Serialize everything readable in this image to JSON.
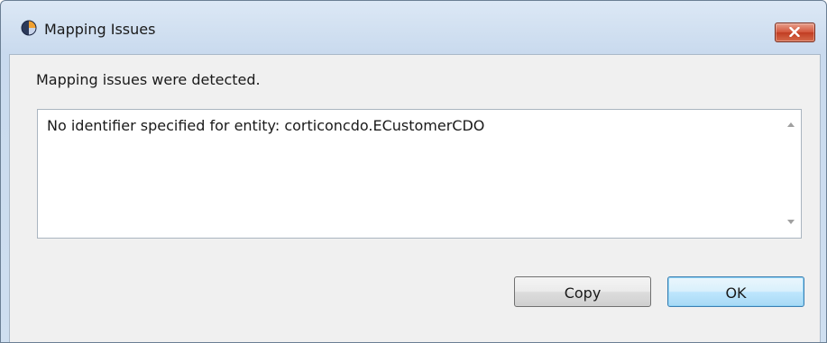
{
  "window": {
    "title": "Mapping Issues",
    "app_icon": "eclipse-app-icon",
    "close_icon": "close-x-icon",
    "close_button_color": "#c13d22"
  },
  "dialog": {
    "message": "Mapping issues were detected.",
    "issues_text": "No identifier specified for entity: corticoncdo.ECustomerCDO",
    "scroll_up_icon": "scroll-up-arrow-icon",
    "scroll_down_icon": "scroll-down-arrow-icon"
  },
  "buttons": {
    "copy_label": "Copy",
    "ok_label": "OK",
    "default_accent": "#3c7fb1"
  }
}
